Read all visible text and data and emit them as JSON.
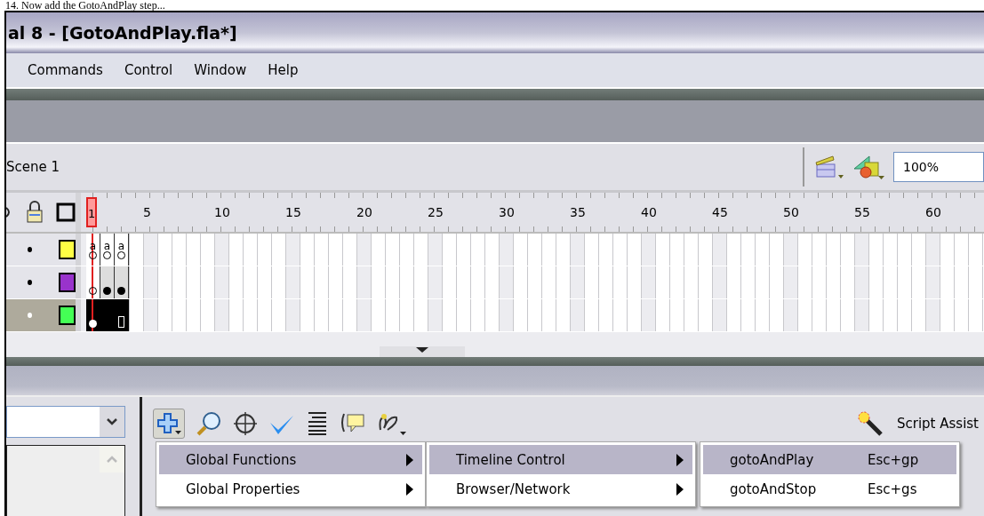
{
  "caption": "14. Now add the GotoAndPlay step...",
  "window": {
    "title": "al 8 - [GotoAndPlay.fla*]"
  },
  "menu": [
    "Commands",
    "Control",
    "Window",
    "Help"
  ],
  "scene": {
    "label": "Scene 1",
    "zoom": "100%"
  },
  "timeline": {
    "ruler": [
      "1",
      "5",
      "10",
      "15",
      "20",
      "25",
      "30",
      "35",
      "40",
      "45",
      "50",
      "55",
      "60"
    ],
    "layers": [
      {
        "color": "#ffff44",
        "selected": false,
        "frames": [
          {
            "kind": "action-empty",
            "label": "a"
          },
          {
            "kind": "action-empty",
            "label": "a"
          },
          {
            "kind": "action-empty",
            "label": "a"
          }
        ]
      },
      {
        "color": "#9933cc",
        "selected": false,
        "frames": [
          {
            "kind": "empty-key"
          },
          {
            "kind": "key"
          },
          {
            "kind": "key"
          }
        ]
      },
      {
        "color": "#44ff55",
        "selected": true,
        "frames": [
          {
            "kind": "key"
          },
          {
            "kind": "span"
          },
          {
            "kind": "end"
          }
        ]
      }
    ]
  },
  "actions": {
    "script_assist": "Script Assist",
    "menus": [
      [
        {
          "label": "Global Functions",
          "selected": true
        },
        {
          "label": "Global Properties",
          "selected": false
        }
      ],
      [
        {
          "label": "Timeline Control",
          "selected": true
        },
        {
          "label": "Browser/Network",
          "selected": false
        }
      ],
      [
        {
          "label": "gotoAndPlay",
          "shortcut": "Esc+gp",
          "selected": true
        },
        {
          "label": "gotoAndStop",
          "shortcut": "Esc+gs",
          "selected": false
        }
      ]
    ]
  }
}
